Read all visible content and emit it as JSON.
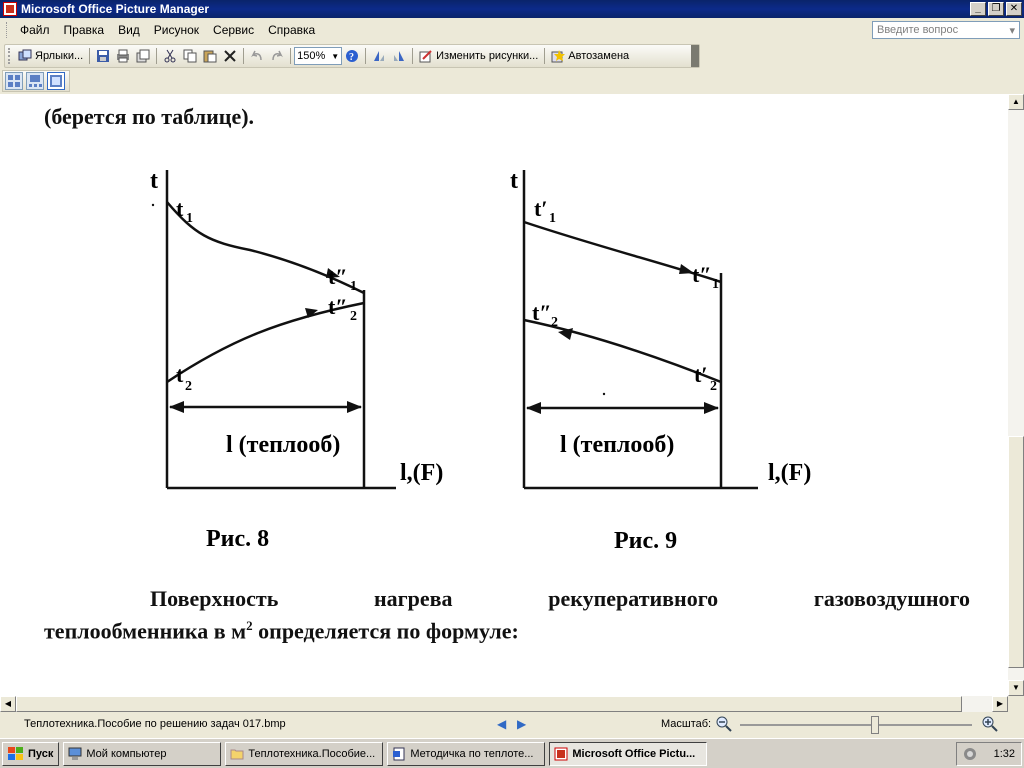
{
  "window": {
    "title": "Microsoft Office Picture Manager"
  },
  "menu": {
    "items": [
      "Файл",
      "Правка",
      "Вид",
      "Рисунок",
      "Сервис",
      "Справка"
    ],
    "ask_placeholder": "Введите вопрос"
  },
  "toolbar": {
    "shortcuts_label": "Ярлыки...",
    "zoom_value": "150%",
    "edit_label": "Изменить рисунки...",
    "autofix_label": "Автозамена"
  },
  "document": {
    "top_text": "(берется по таблице).",
    "fig8": {
      "axis_t": "t",
      "label_t1": "t",
      "sub_t1": "1",
      "label_t1pp": "t″",
      "sub_t1pp": "1",
      "label_t2pp": "t″",
      "sub_t2pp": "2",
      "label_t2": "t",
      "sub_t2": "2",
      "dim_label": "l (теплооб)",
      "axis_x": "l,(F)",
      "caption": "Рис. 8"
    },
    "fig9": {
      "axis_t": "t",
      "label_t1p": "t′",
      "sub_t1p": "1",
      "label_t1pp": "t″",
      "sub_t1pp": "1",
      "label_t2pp": "t″",
      "sub_t2pp": "2",
      "label_t2p": "t′",
      "sub_t2p": "2",
      "dim_label": "l (теплооб)",
      "axis_x": "l,(F)",
      "caption": "Рис. 9"
    },
    "para_line1_words": [
      "Поверхность",
      "нагрева",
      "рекуперативного",
      "газовоздушного"
    ],
    "para_line2_a": "теплообменника в м",
    "para_line2_sup": "2",
    "para_line2_b": " определяется по формуле:"
  },
  "status": {
    "filename": "Теплотехника.Пособие по решению задач 017.bmp",
    "zoom_label": "Масштаб:",
    "zoom_level": 0.58
  },
  "taskbar": {
    "start": "Пуск",
    "tasks": [
      "Мой компьютер",
      "Теплотехника.Пособие...",
      "Методичка по теплоте...",
      "Microsoft Office Pictu..."
    ],
    "clock": "1:32"
  }
}
